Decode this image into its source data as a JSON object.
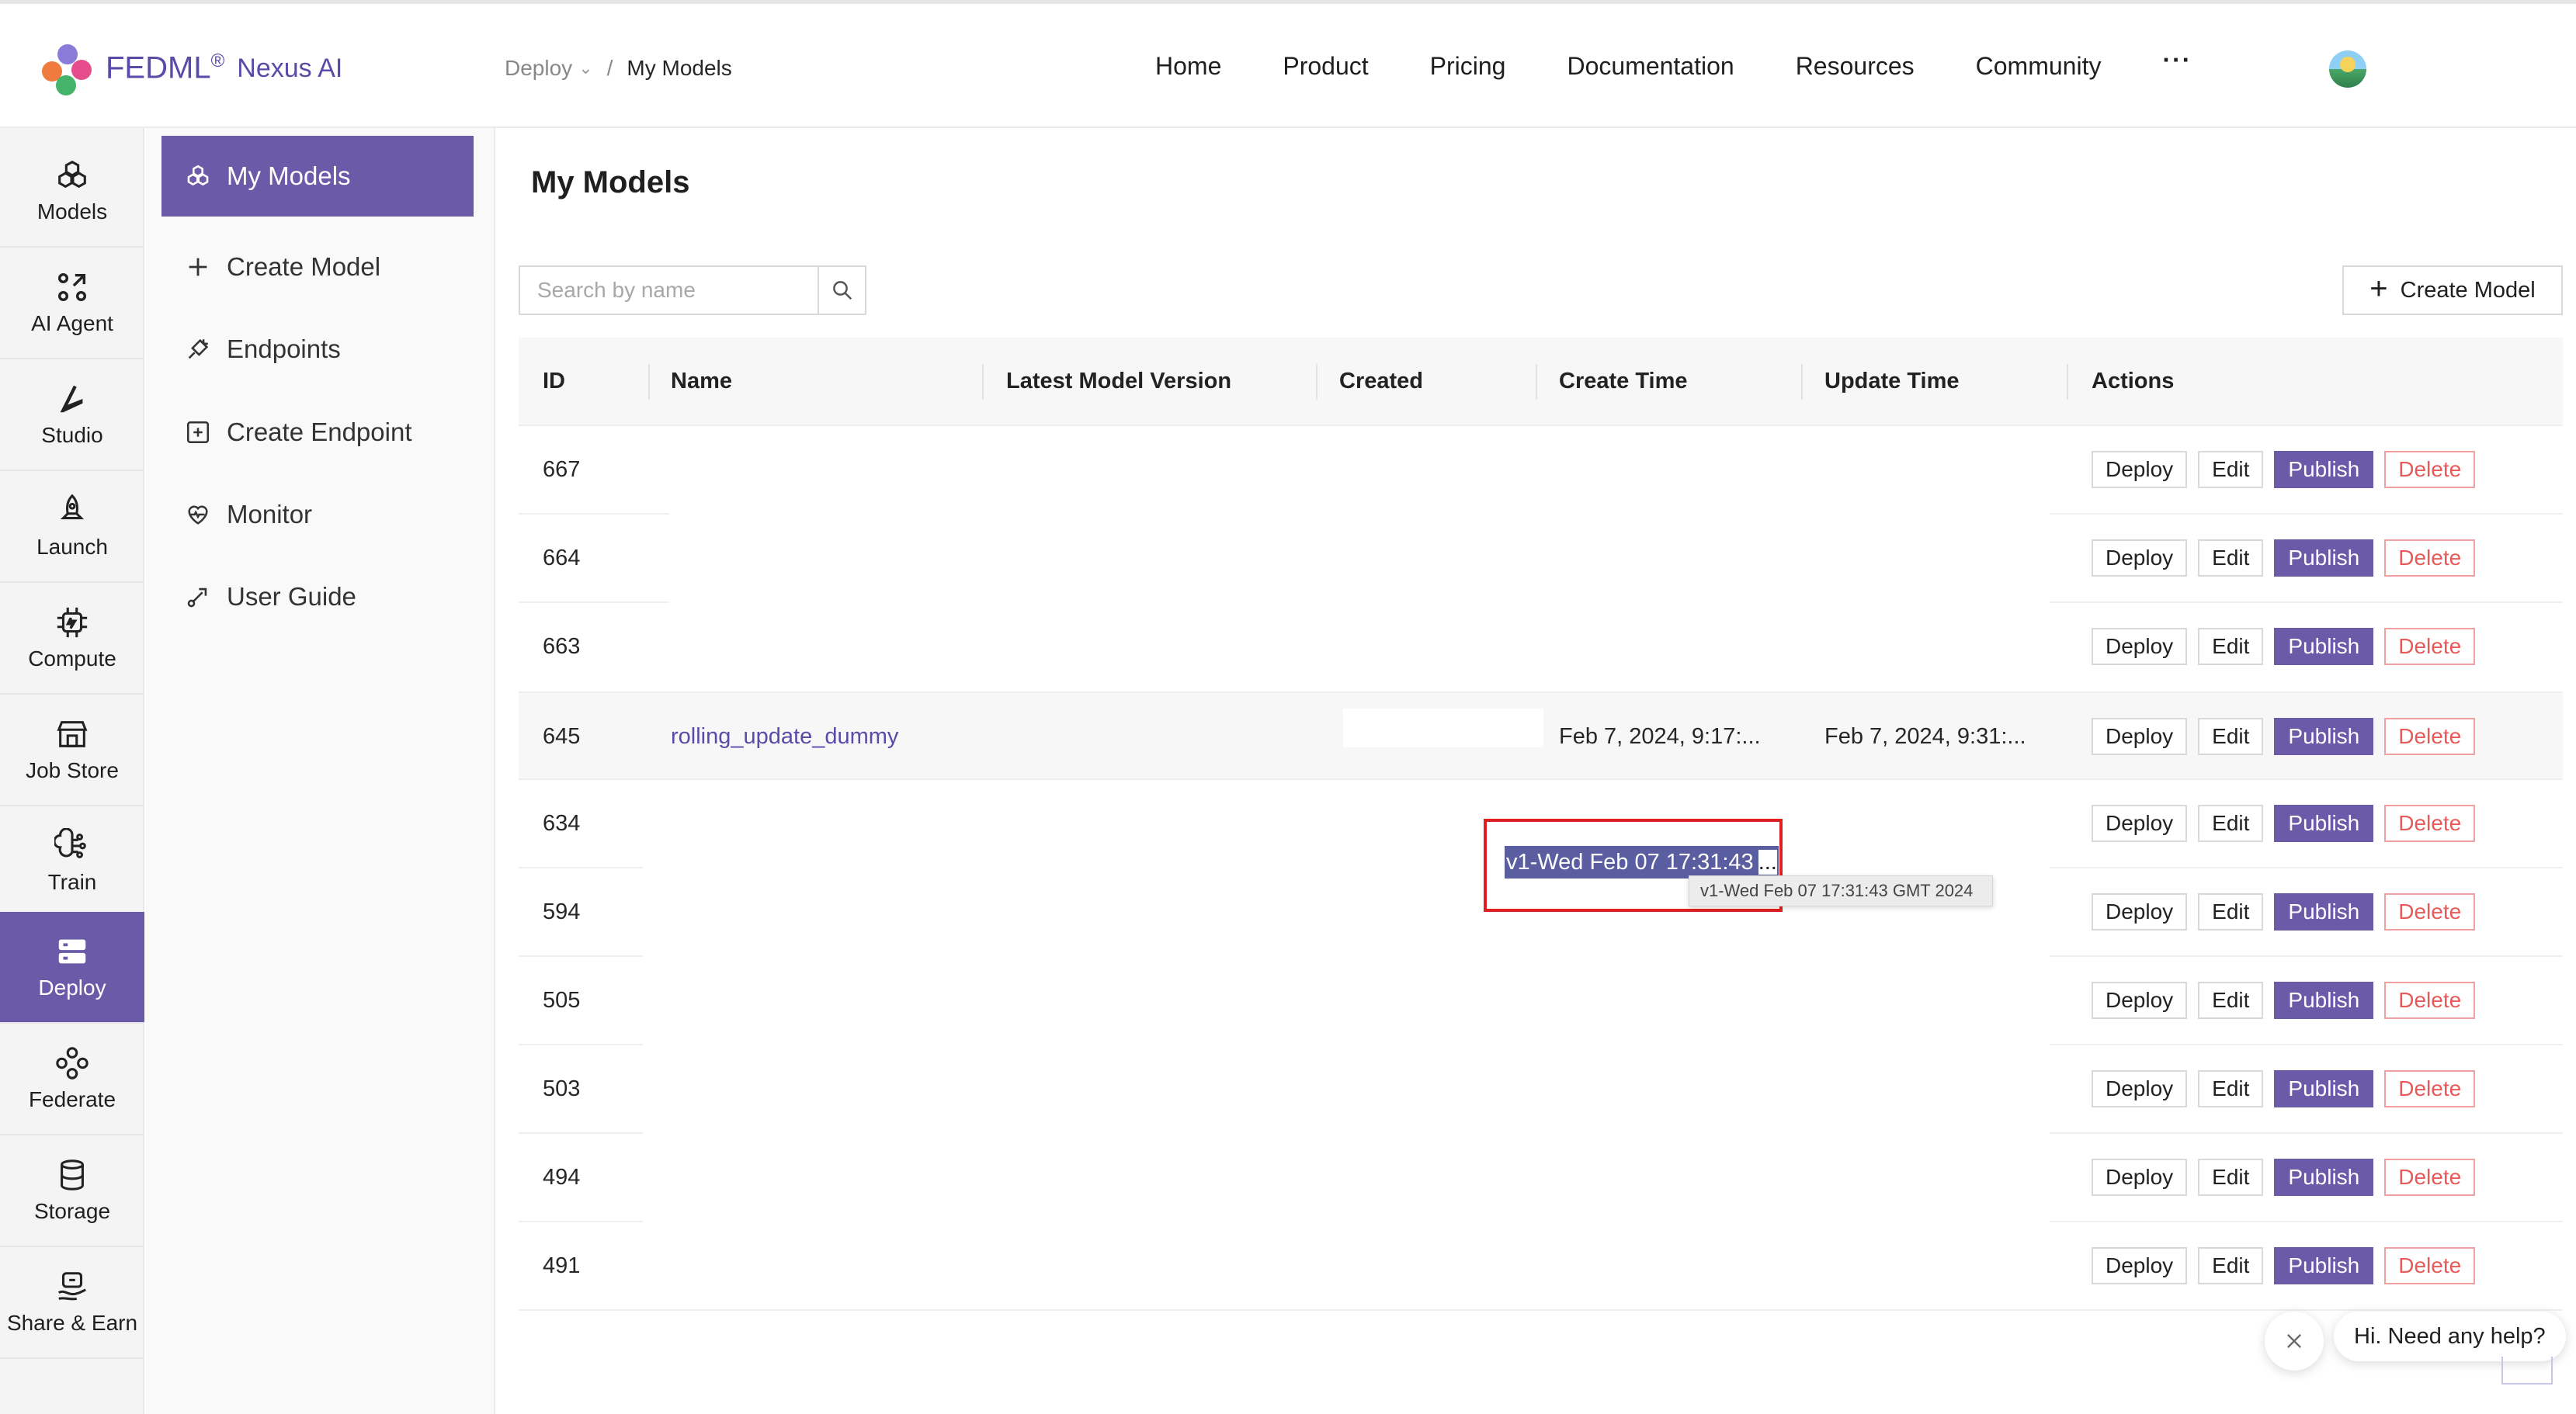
{
  "brand": {
    "name": "FEDML",
    "reg": "®",
    "sub": "Nexus AI"
  },
  "breadcrumb": {
    "parent": "Deploy",
    "current": "My Models"
  },
  "nav": [
    "Home",
    "Product",
    "Pricing",
    "Documentation",
    "Resources",
    "Community",
    "···"
  ],
  "rail": [
    {
      "label": "Models",
      "icon": "models-icon"
    },
    {
      "label": "AI Agent",
      "icon": "ai-agent-icon"
    },
    {
      "label": "Studio",
      "icon": "studio-icon"
    },
    {
      "label": "Launch",
      "icon": "launch-icon"
    },
    {
      "label": "Compute",
      "icon": "compute-icon"
    },
    {
      "label": "Job Store",
      "icon": "job-store-icon"
    },
    {
      "label": "Train",
      "icon": "train-icon"
    },
    {
      "label": "Deploy",
      "icon": "deploy-icon",
      "active": true
    },
    {
      "label": "Federate",
      "icon": "federate-icon"
    },
    {
      "label": "Storage",
      "icon": "storage-icon"
    },
    {
      "label": "Share & Earn",
      "icon": "share-earn-icon"
    }
  ],
  "subnav": [
    {
      "label": "My Models",
      "icon": "models-icon",
      "active": true
    },
    {
      "label": "Create Model",
      "icon": "plus-icon"
    },
    {
      "label": "Endpoints",
      "icon": "endpoints-icon"
    },
    {
      "label": "Create Endpoint",
      "icon": "plus-square-icon"
    },
    {
      "label": "Monitor",
      "icon": "monitor-icon"
    },
    {
      "label": "User Guide",
      "icon": "user-guide-icon"
    }
  ],
  "page": {
    "title": "My Models",
    "search_placeholder": "Search by name",
    "create_label": "Create Model"
  },
  "table": {
    "columns": [
      "ID",
      "Name",
      "Latest Model Version",
      "Created",
      "Create Time",
      "Update Time",
      "Actions"
    ],
    "actions": [
      "Deploy",
      "Edit",
      "Publish",
      "Delete"
    ],
    "rows": [
      {
        "id": "667",
        "name": "",
        "version": "",
        "created": "",
        "create_time": "",
        "update_time": ""
      },
      {
        "id": "664",
        "name": "",
        "version": "",
        "created": "",
        "create_time": "",
        "update_time": ""
      },
      {
        "id": "663",
        "name": "",
        "version": "",
        "created": "",
        "create_time": "",
        "update_time": ""
      },
      {
        "id": "645",
        "name": "rolling_update_dummy",
        "version": "v1-Wed Feb 07 17:31:43",
        "version_ellipsis": "...",
        "created": "",
        "create_time": "Feb 7, 2024, 9:17:...",
        "update_time": "Feb 7, 2024, 9:31:...",
        "tooltip": "v1-Wed Feb 07 17:31:43 GMT 2024"
      },
      {
        "id": "634",
        "name": "",
        "version": "",
        "created": "",
        "create_time": "",
        "update_time": ""
      },
      {
        "id": "594",
        "name": "",
        "version": "",
        "created": "",
        "create_time": "",
        "update_time": ""
      },
      {
        "id": "505",
        "name": "",
        "version": "",
        "created": "",
        "create_time": "",
        "update_time": ""
      },
      {
        "id": "503",
        "name": "",
        "version": "",
        "created": "",
        "create_time": "",
        "update_time": ""
      },
      {
        "id": "494",
        "name": "",
        "version": "",
        "created": "",
        "create_time": "",
        "update_time": ""
      },
      {
        "id": "491",
        "name": "",
        "version": "",
        "created": "",
        "create_time": "",
        "update_time": ""
      }
    ]
  },
  "help": {
    "text": "Hi. Need any help?"
  },
  "colors": {
    "accent": "#6a5aa8",
    "danger": "#e85a5a",
    "highlight_box": "#e02020"
  }
}
